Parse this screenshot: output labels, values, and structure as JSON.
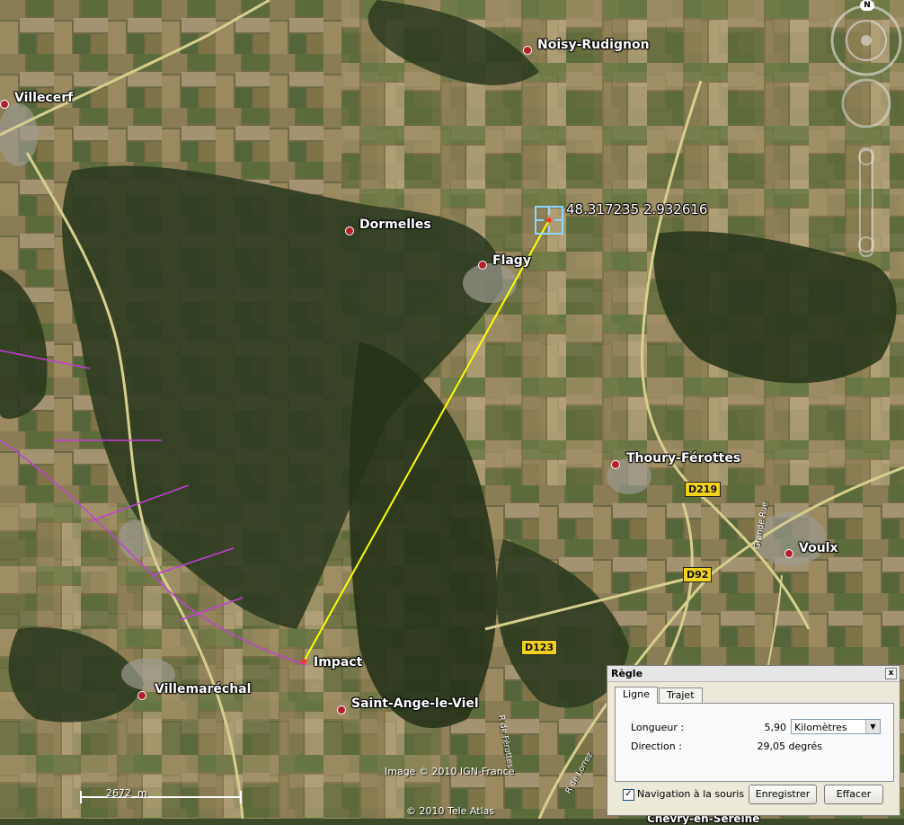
{
  "map": {
    "places": [
      {
        "id": "noisy-rudignon",
        "name": "Noisy-Rudignon"
      },
      {
        "id": "villecerf",
        "name": "Villecerf"
      },
      {
        "id": "dormelles",
        "name": "Dormelles"
      },
      {
        "id": "flagy",
        "name": "Flagy"
      },
      {
        "id": "thoury-ferottes",
        "name": "Thoury-Férottes"
      },
      {
        "id": "voulx",
        "name": "Voulx"
      },
      {
        "id": "villemarechal",
        "name": "Villemaréchal"
      },
      {
        "id": "saint-ange-le-viel",
        "name": "Saint-Ange-le-Viel"
      }
    ],
    "markers": {
      "impact": "Impact",
      "coordinates": "48.317235 2.932616"
    },
    "roads": {
      "d219": "D219",
      "d92": "D92",
      "d123": "D123",
      "grande_rue": "Grande Rue",
      "rue_ferottes": "R de Férottes",
      "rue_lorrez": "R de Lorrez",
      "bottom_partial": "Chevry-en-Sereine"
    },
    "credits": {
      "ign": "Image © 2010 IGN-France",
      "tele_atlas": "© 2010 Tele Atlas"
    },
    "scale": "2672  m",
    "compass_north": "N"
  },
  "ruler": {
    "title": "Règle",
    "close_glyph": "x",
    "tabs": [
      "Ligne",
      "Trajet"
    ],
    "length_label": "Longueur :",
    "length_value": "5,90",
    "unit": "Kilomètres",
    "direction_label": "Direction :",
    "direction_value": "29,05 degrés",
    "mouse_nav_label": "Navigation à la souris",
    "mouse_nav_checked": true,
    "save_button": "Enregistrer",
    "clear_button": "Effacer"
  },
  "colors": {
    "ruler_line": "#ffff00",
    "place_dot": "#b3202a",
    "road_badge": "#f2d21b",
    "admin_border": "#c23fd8"
  }
}
